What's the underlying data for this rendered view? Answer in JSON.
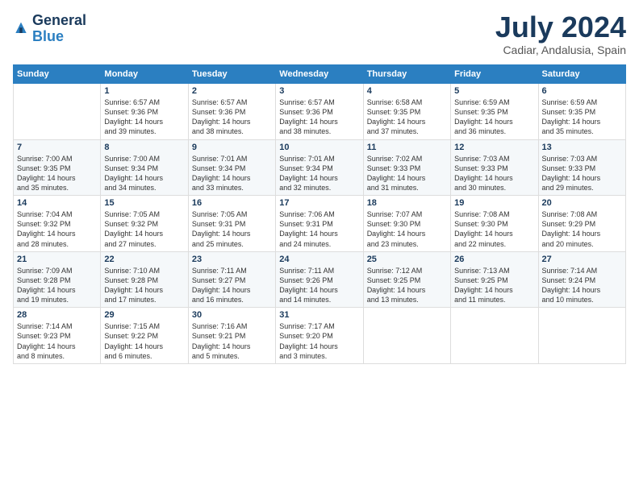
{
  "header": {
    "logo_line1": "General",
    "logo_line2": "Blue",
    "month_title": "July 2024",
    "location": "Cadiar, Andalusia, Spain"
  },
  "weekdays": [
    "Sunday",
    "Monday",
    "Tuesday",
    "Wednesday",
    "Thursday",
    "Friday",
    "Saturday"
  ],
  "weeks": [
    [
      {
        "day": "",
        "info": ""
      },
      {
        "day": "1",
        "info": "Sunrise: 6:57 AM\nSunset: 9:36 PM\nDaylight: 14 hours\nand 39 minutes."
      },
      {
        "day": "2",
        "info": "Sunrise: 6:57 AM\nSunset: 9:36 PM\nDaylight: 14 hours\nand 38 minutes."
      },
      {
        "day": "3",
        "info": "Sunrise: 6:57 AM\nSunset: 9:36 PM\nDaylight: 14 hours\nand 38 minutes."
      },
      {
        "day": "4",
        "info": "Sunrise: 6:58 AM\nSunset: 9:35 PM\nDaylight: 14 hours\nand 37 minutes."
      },
      {
        "day": "5",
        "info": "Sunrise: 6:59 AM\nSunset: 9:35 PM\nDaylight: 14 hours\nand 36 minutes."
      },
      {
        "day": "6",
        "info": "Sunrise: 6:59 AM\nSunset: 9:35 PM\nDaylight: 14 hours\nand 35 minutes."
      }
    ],
    [
      {
        "day": "7",
        "info": "Sunrise: 7:00 AM\nSunset: 9:35 PM\nDaylight: 14 hours\nand 35 minutes."
      },
      {
        "day": "8",
        "info": "Sunrise: 7:00 AM\nSunset: 9:34 PM\nDaylight: 14 hours\nand 34 minutes."
      },
      {
        "day": "9",
        "info": "Sunrise: 7:01 AM\nSunset: 9:34 PM\nDaylight: 14 hours\nand 33 minutes."
      },
      {
        "day": "10",
        "info": "Sunrise: 7:01 AM\nSunset: 9:34 PM\nDaylight: 14 hours\nand 32 minutes."
      },
      {
        "day": "11",
        "info": "Sunrise: 7:02 AM\nSunset: 9:33 PM\nDaylight: 14 hours\nand 31 minutes."
      },
      {
        "day": "12",
        "info": "Sunrise: 7:03 AM\nSunset: 9:33 PM\nDaylight: 14 hours\nand 30 minutes."
      },
      {
        "day": "13",
        "info": "Sunrise: 7:03 AM\nSunset: 9:33 PM\nDaylight: 14 hours\nand 29 minutes."
      }
    ],
    [
      {
        "day": "14",
        "info": "Sunrise: 7:04 AM\nSunset: 9:32 PM\nDaylight: 14 hours\nand 28 minutes."
      },
      {
        "day": "15",
        "info": "Sunrise: 7:05 AM\nSunset: 9:32 PM\nDaylight: 14 hours\nand 27 minutes."
      },
      {
        "day": "16",
        "info": "Sunrise: 7:05 AM\nSunset: 9:31 PM\nDaylight: 14 hours\nand 25 minutes."
      },
      {
        "day": "17",
        "info": "Sunrise: 7:06 AM\nSunset: 9:31 PM\nDaylight: 14 hours\nand 24 minutes."
      },
      {
        "day": "18",
        "info": "Sunrise: 7:07 AM\nSunset: 9:30 PM\nDaylight: 14 hours\nand 23 minutes."
      },
      {
        "day": "19",
        "info": "Sunrise: 7:08 AM\nSunset: 9:30 PM\nDaylight: 14 hours\nand 22 minutes."
      },
      {
        "day": "20",
        "info": "Sunrise: 7:08 AM\nSunset: 9:29 PM\nDaylight: 14 hours\nand 20 minutes."
      }
    ],
    [
      {
        "day": "21",
        "info": "Sunrise: 7:09 AM\nSunset: 9:28 PM\nDaylight: 14 hours\nand 19 minutes."
      },
      {
        "day": "22",
        "info": "Sunrise: 7:10 AM\nSunset: 9:28 PM\nDaylight: 14 hours\nand 17 minutes."
      },
      {
        "day": "23",
        "info": "Sunrise: 7:11 AM\nSunset: 9:27 PM\nDaylight: 14 hours\nand 16 minutes."
      },
      {
        "day": "24",
        "info": "Sunrise: 7:11 AM\nSunset: 9:26 PM\nDaylight: 14 hours\nand 14 minutes."
      },
      {
        "day": "25",
        "info": "Sunrise: 7:12 AM\nSunset: 9:25 PM\nDaylight: 14 hours\nand 13 minutes."
      },
      {
        "day": "26",
        "info": "Sunrise: 7:13 AM\nSunset: 9:25 PM\nDaylight: 14 hours\nand 11 minutes."
      },
      {
        "day": "27",
        "info": "Sunrise: 7:14 AM\nSunset: 9:24 PM\nDaylight: 14 hours\nand 10 minutes."
      }
    ],
    [
      {
        "day": "28",
        "info": "Sunrise: 7:14 AM\nSunset: 9:23 PM\nDaylight: 14 hours\nand 8 minutes."
      },
      {
        "day": "29",
        "info": "Sunrise: 7:15 AM\nSunset: 9:22 PM\nDaylight: 14 hours\nand 6 minutes."
      },
      {
        "day": "30",
        "info": "Sunrise: 7:16 AM\nSunset: 9:21 PM\nDaylight: 14 hours\nand 5 minutes."
      },
      {
        "day": "31",
        "info": "Sunrise: 7:17 AM\nSunset: 9:20 PM\nDaylight: 14 hours\nand 3 minutes."
      },
      {
        "day": "",
        "info": ""
      },
      {
        "day": "",
        "info": ""
      },
      {
        "day": "",
        "info": ""
      }
    ]
  ]
}
